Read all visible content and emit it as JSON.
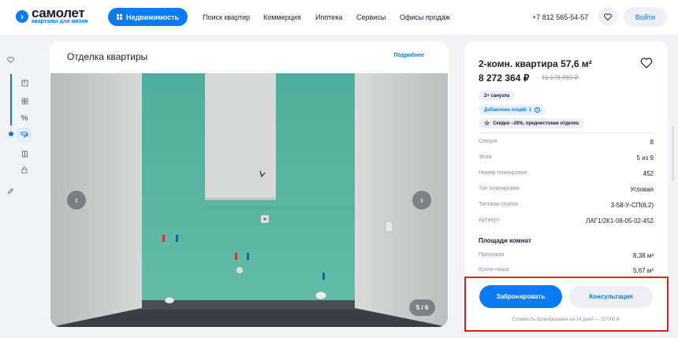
{
  "header": {
    "logo_name": "самолет",
    "logo_tagline": "кварталы для жизни",
    "realty_button": "Недвижимость",
    "nav": [
      "Поиск квартир",
      "Коммерция",
      "Ипотека",
      "Сервисы",
      "Офисы продаж"
    ],
    "phone": "+7 812 565-54-57",
    "login": "Войти"
  },
  "rail": {
    "icons": [
      "heart-icon",
      "floorplan-icon",
      "tiles-icon",
      "percent-icon",
      "paint-roller-icon",
      "door-icon",
      "lock-icon",
      "pencil-icon"
    ],
    "percent_glyph": "%"
  },
  "gallery": {
    "title": "Отделка квартиры",
    "more_link": "Подробнее",
    "counter": "5 / 6",
    "prev_glyph": "‹",
    "next_glyph": "›"
  },
  "apartment": {
    "title": "2-комн. квартира 57,6 м²",
    "price": "8 272 364 ₽",
    "old_price": "11 178 869 ₽",
    "tags": {
      "bathrooms": "2+ санузла",
      "options": "Добавлено опций: 1",
      "discount": "Скидка −26%, предчистовая отделка"
    },
    "specs": [
      {
        "label": "Секция",
        "value": "8"
      },
      {
        "label": "Этаж",
        "value": "5 из 9"
      },
      {
        "label": "Номер планировки",
        "value": "452"
      },
      {
        "label": "Тип планировки",
        "value": "Угловая"
      },
      {
        "label": "Типовая группа",
        "value": "3-58-У-СП(8.2)"
      },
      {
        "label": "Артикул",
        "value": "ЛАГ1/2К1-08-05-02-452"
      }
    ],
    "rooms_title": "Площади комнат",
    "rooms": [
      {
        "label": "Прихожая",
        "value": "8,38 м²"
      },
      {
        "label": "Кухня-ниша",
        "value": "5,67 м²"
      }
    ]
  },
  "booking": {
    "book_label": "Забронировать",
    "consult_label": "Консультация",
    "note": "Стоимость бронирования на 14 дней — 10 000 ₽"
  },
  "colors": {
    "accent": "#0b7bf4",
    "highlight": "#e11b22",
    "wall_teal": "#5fb7a5",
    "concrete": "#cfd1d1"
  }
}
